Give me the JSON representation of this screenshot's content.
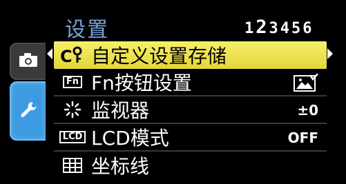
{
  "header": {
    "title": "设置",
    "pages": [
      "1",
      "2",
      "3",
      "4",
      "5",
      "6"
    ],
    "current_page": "2"
  },
  "tabs": [
    {
      "name": "camera",
      "icon": "camera-icon",
      "active": false
    },
    {
      "name": "setup",
      "icon": "wrench-icon",
      "active": true
    }
  ],
  "menu": {
    "items": [
      {
        "icon": "custom-set-icon",
        "icon_text": "C",
        "label": "自定义设置存储",
        "value": "",
        "selected": true
      },
      {
        "icon": "fn-icon",
        "icon_text": "Fn",
        "label": "Fn按钮设置",
        "value": "",
        "value_icon": "fn-assigned-picture-icon",
        "selected": false
      },
      {
        "icon": "brightness-icon",
        "icon_text": "",
        "label": "监视器",
        "value": "±0",
        "selected": false
      },
      {
        "icon": "lcd-icon",
        "icon_text": "LCD",
        "label": "LCD模式",
        "value": "OFF",
        "selected": false
      },
      {
        "icon": "grid-icon",
        "icon_text": "",
        "label": "坐标线",
        "value": "",
        "selected": false
      }
    ]
  },
  "colors": {
    "title": "#7aa3d6",
    "selected_row": "#ece04a",
    "active_tab": "#3c9be0"
  }
}
